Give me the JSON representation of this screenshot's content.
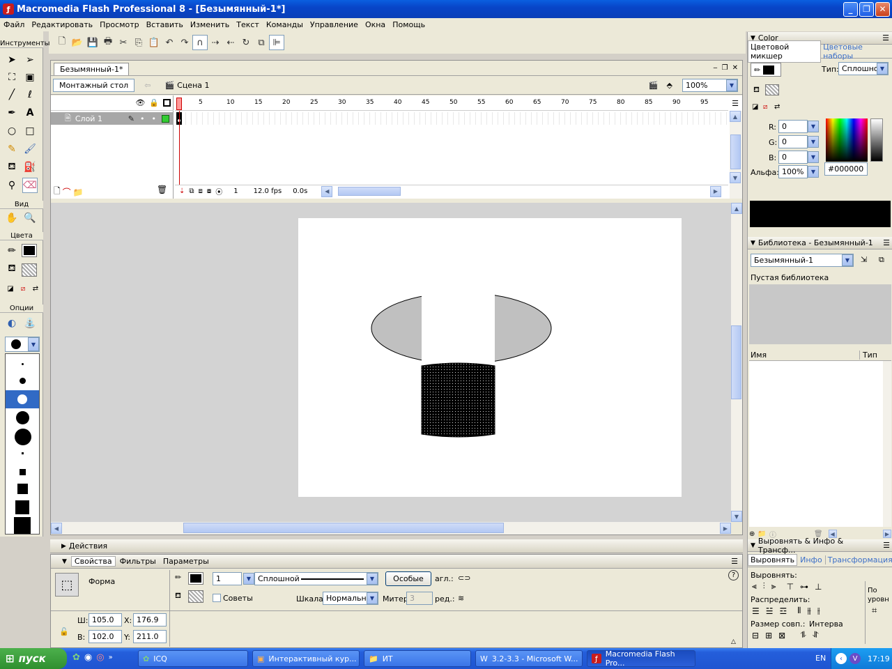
{
  "window": {
    "title": "Macromedia Flash Professional 8 - [Безымянный-1*]"
  },
  "menu": [
    "Файл",
    "Редактировать",
    "Просмотр",
    "Вставить",
    "Изменить",
    "Текст",
    "Команды",
    "Управление",
    "Окна",
    "Помощь"
  ],
  "tools_panel": {
    "title": "Инструменты",
    "view_label": "Вид",
    "colors_label": "Цвета",
    "options_label": "Опции"
  },
  "document": {
    "tab": "Безымянный-1*",
    "stage_button": "Монтажный стол",
    "scene": "Сцена 1",
    "zoom": "100%",
    "layer": "Слой 1",
    "frame_ticks": [
      "5",
      "10",
      "15",
      "20",
      "25",
      "30",
      "35",
      "40",
      "45",
      "50",
      "55",
      "60",
      "65",
      "70",
      "75",
      "80",
      "85",
      "90",
      "95"
    ],
    "current_frame": "1",
    "fps": "12.0 fps",
    "time": "0.0s"
  },
  "color_panel": {
    "title": "Color",
    "tab_mixer": "Цветовой микшер",
    "tab_swatches": "Цветовые наборы",
    "type_label": "Тип:",
    "type_value": "Сплошной",
    "r_label": "R:",
    "r": "0",
    "g_label": "G:",
    "g": "0",
    "b_label": "B:",
    "b": "0",
    "alpha_label": "Альфа:",
    "alpha": "100%",
    "hex": "#000000",
    "preview_color": "#000000"
  },
  "library_panel": {
    "title": "Библиотека - Безымянный-1",
    "select": "Безымянный-1",
    "empty": "Пустая библиотека",
    "col_name": "Имя",
    "col_type": "Тип"
  },
  "align_panel": {
    "title": "Выровнять & Инфо & Трансф...",
    "tab_align": "Выровнять",
    "tab_info": "Инфо",
    "tab_transform": "Трансформация",
    "align_label": "Выровнять:",
    "distribute_label": "Распределить:",
    "match_label": "Размер совп.:",
    "space_label": "Интерва",
    "to_stage": "По уровн"
  },
  "actions_panel": {
    "title": "Действия"
  },
  "properties": {
    "tab_props": "Свойства",
    "tab_filters": "Фильтры",
    "tab_params": "Параметры",
    "shape_label": "Форма",
    "stroke_width": "1",
    "stroke_style": "Сплошной",
    "custom_button": "Особые",
    "cap_label": "агл.:",
    "join_label": "ред.:",
    "hints_label": "Советы",
    "scale_label": "Шкала:",
    "scale_value": "Нормально",
    "miter_label": "Митер",
    "miter_value": "3",
    "w_label": "Ш:",
    "w": "105.0",
    "h_label": "В:",
    "h": "102.0",
    "x_label": "X:",
    "x": "176.9",
    "y_label": "Y:",
    "y": "211.0"
  },
  "taskbar": {
    "start": "пуск",
    "tasks": [
      "ICQ",
      "Интерактивный кур...",
      "ИТ",
      "3.2-3.3 - Microsoft W...",
      "Macromedia Flash Pro..."
    ],
    "lang": "EN",
    "clock": "17:19"
  },
  "colors": {
    "accent": "#0a5fe0",
    "playhead": "#cc0000",
    "layer_color": "#33cc33"
  }
}
